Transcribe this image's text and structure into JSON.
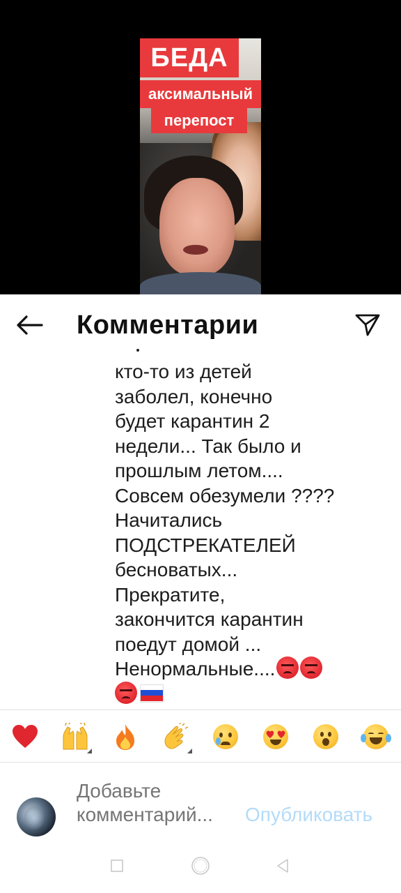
{
  "video": {
    "banner_line1": "БЕДА",
    "banner_line2": "аксимальный",
    "banner_line3": "перепост",
    "banner_color": "#e83a3c"
  },
  "header": {
    "title": "Комментарии",
    "back_icon": "arrow-left-icon",
    "share_icon": "paper-plane-icon"
  },
  "comment": {
    "lines": [
      "кто-то из детей",
      "заболел, конечно",
      "будет карантин 2",
      "недели... Так было и",
      "прошлым летом....",
      "Совсем обезумели ????",
      "Начитались",
      "ПОДСТРЕКАТЕЛЕЙ",
      "бесноватых...",
      "Прекратите,",
      "закончится карантин",
      "поедут домой ...",
      "Ненормальные...."
    ],
    "trailing_emojis": [
      "angry-face-emoji",
      "angry-face-emoji",
      "angry-face-emoji",
      "russia-flag-emoji"
    ]
  },
  "reactions": [
    {
      "name": "red-heart",
      "glyph": "❤"
    },
    {
      "name": "raising-hands",
      "glyph": "🙌"
    },
    {
      "name": "fire",
      "glyph": "🔥"
    },
    {
      "name": "clapping-hands",
      "glyph": "👏"
    },
    {
      "name": "crying-face",
      "glyph": "😢"
    },
    {
      "name": "heart-eyes-face",
      "glyph": "😍"
    },
    {
      "name": "surprised-face",
      "glyph": "😮"
    },
    {
      "name": "tears-of-joy-face",
      "glyph": "😂"
    }
  ],
  "composer": {
    "placeholder": "Добавьте комментарий...",
    "publish_label": "Опубликовать",
    "publish_color": "#b3dbf9",
    "placeholder_color": "#a9a9a9"
  },
  "navbar": {
    "recents_icon": "square-icon",
    "home_icon": "circle-icon",
    "back_icon": "triangle-back-icon"
  }
}
